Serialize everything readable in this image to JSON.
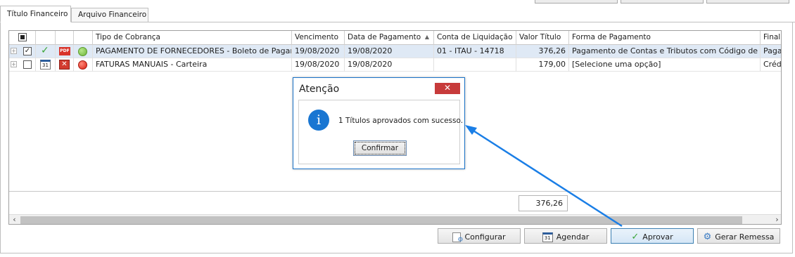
{
  "tabs": [
    {
      "label": "Título Financeiro",
      "active": true
    },
    {
      "label": "Arquivo Financeiro",
      "active": false
    }
  ],
  "grid": {
    "columns": [
      "Tipo de Cobrança",
      "Vencimento",
      "Data de Pagamento",
      "Conta de Liquidação",
      "Valor Título",
      "Forma de Pagamento",
      "Finali"
    ],
    "rows": [
      {
        "tipo": "PAGAMENTO DE FORNECEDORES - Boleto de Pagamento",
        "vencimento": "19/08/2020",
        "data_pagamento": "19/08/2020",
        "conta": "01 - ITAU - 14718",
        "valor": "376,26",
        "forma": "Pagamento de Contas e Tributos com Código de Barras",
        "finali": "Paga",
        "checked": true,
        "status_color": "#7cc142"
      },
      {
        "tipo": "FATURAS MANUAIS - Carteira",
        "vencimento": "19/08/2020",
        "data_pagamento": "19/08/2020",
        "conta": "",
        "valor": "179,00",
        "forma": "[Selecione uma opção]",
        "finali": "Crédi",
        "checked": false,
        "status_color": "#e52b1e"
      }
    ],
    "total": "376,26"
  },
  "buttons": {
    "configurar": "Configurar",
    "agendar": "Agendar",
    "aprovar": "Aprovar",
    "gerar_remessa": "Gerar Remessa"
  },
  "dialog": {
    "title": "Atenção",
    "message": "1 Títulos aprovados com sucesso.",
    "confirm": "Confirmar",
    "close": "✕"
  },
  "icons": {
    "calendar_day": "31",
    "pdf": "PDF"
  },
  "colors": {
    "selection": "#dfe9f5",
    "accent": "#1976d2",
    "close": "#c73b3b",
    "annotation_arrow": "#1a7ee6"
  }
}
